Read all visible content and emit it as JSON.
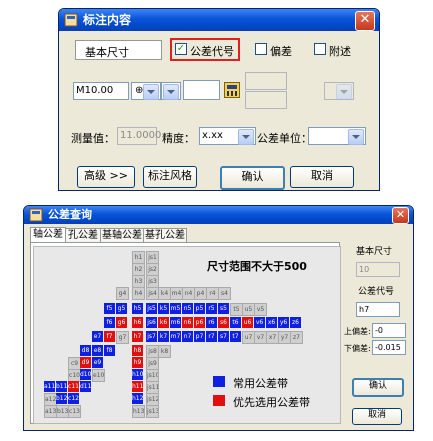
{
  "dialog1": {
    "title": "标注内容",
    "tabs": {
      "basic_size": "基本尺寸",
      "tolerance_code": "公差代号",
      "deviation": "偏差",
      "appendix": "附述"
    },
    "size_value": "M10.00",
    "measured_label": "测量值：",
    "measured_value": "11.0000",
    "precision_label": "精度：",
    "precision_value": "x.xx",
    "tolerance_unit_label": "公差单位：",
    "buttons": {
      "advanced": "高级 >>",
      "style": "标注风格",
      "ok": "确认",
      "cancel": "取消"
    }
  },
  "dialog2": {
    "title": "公差查询",
    "tabs": [
      "轴公差",
      "孔公差",
      "基轴公差",
      "基孔公差"
    ],
    "range_text": "尺寸范围不大于500",
    "legend": {
      "common": "常用公差带",
      "preferred": "优先选用公差带"
    },
    "right": {
      "basic_size_label": "基本尺寸",
      "basic_size_value": "10",
      "code_label": "公差代号",
      "code_value": "h7",
      "upper_label": "上偏差:",
      "upper_value": "-0",
      "lower_label": "下偏差:",
      "lower_value": "-0.015",
      "ok": "确认",
      "cancel": "取消"
    },
    "grid_cells": [
      [
        "h1",
        "d"
      ],
      [
        "h2",
        "d"
      ],
      [
        "h3",
        "d"
      ],
      [
        "js1",
        "d"
      ],
      [
        "js2",
        "d"
      ],
      [
        "js3",
        "d"
      ],
      [
        "g4",
        "d"
      ],
      [
        "h4",
        "d"
      ],
      [
        "js4",
        "d"
      ],
      [
        "k4",
        "d"
      ],
      [
        "m4",
        "d"
      ],
      [
        "n4",
        "d"
      ],
      [
        "p4",
        "d"
      ],
      [
        "r4",
        "d"
      ],
      [
        "s4",
        "d"
      ],
      [
        "f5",
        "b"
      ],
      [
        "g5",
        "b"
      ],
      [
        "h5",
        "b"
      ],
      [
        "js5",
        "b"
      ],
      [
        "k5",
        "b"
      ],
      [
        "m5",
        "b"
      ],
      [
        "n5",
        "b"
      ],
      [
        "p5",
        "b"
      ],
      [
        "r5",
        "b"
      ],
      [
        "s5",
        "b"
      ],
      [
        "t5",
        "d"
      ],
      [
        "u5",
        "d"
      ],
      [
        "v5",
        "d"
      ],
      [
        "f6",
        "b"
      ],
      [
        "g6",
        "r"
      ],
      [
        "h6",
        "r"
      ],
      [
        "js6",
        "b"
      ],
      [
        "k6",
        "r"
      ],
      [
        "m6",
        "b"
      ],
      [
        "n6",
        "r"
      ],
      [
        "p6",
        "r"
      ],
      [
        "r6",
        "b"
      ],
      [
        "s6",
        "r"
      ],
      [
        "t6",
        "b"
      ],
      [
        "u6",
        "r"
      ],
      [
        "v6",
        "b"
      ],
      [
        "x6",
        "b"
      ],
      [
        "y6",
        "b"
      ],
      [
        "z6",
        "b"
      ],
      [
        "e7",
        "b"
      ],
      [
        "f7",
        "r"
      ],
      [
        "g7",
        "d"
      ],
      [
        "h7",
        "r"
      ],
      [
        "js7",
        "b"
      ],
      [
        "k7",
        "b"
      ],
      [
        "m7",
        "b"
      ],
      [
        "n7",
        "b"
      ],
      [
        "p7",
        "b"
      ],
      [
        "r7",
        "b"
      ],
      [
        "s7",
        "b"
      ],
      [
        "t7",
        "b"
      ],
      [
        "u7",
        "d"
      ],
      [
        "v7",
        "d"
      ],
      [
        "x7",
        "d"
      ],
      [
        "y7",
        "d"
      ],
      [
        "z7",
        "d"
      ],
      [
        "d8",
        "b"
      ],
      [
        "e8",
        "b"
      ],
      [
        "f8",
        "b"
      ],
      [
        "h8",
        "r"
      ],
      [
        "js8",
        "d"
      ],
      [
        "k8",
        "d"
      ],
      [
        "c9",
        "d"
      ],
      [
        "d9",
        "r"
      ],
      [
        "e9",
        "b"
      ],
      [
        "h9",
        "r"
      ],
      [
        "js9",
        "d"
      ],
      [
        "c10",
        "d"
      ],
      [
        "d10",
        "b"
      ],
      [
        "e10",
        "d"
      ],
      [
        "h10",
        "b"
      ],
      [
        "js10",
        "d"
      ],
      [
        "a11",
        "b"
      ],
      [
        "b11",
        "b"
      ],
      [
        "c11",
        "r"
      ],
      [
        "d11",
        "b"
      ],
      [
        "h11",
        "r"
      ],
      [
        "js11",
        "d"
      ],
      [
        "a12",
        "d"
      ],
      [
        "b12",
        "b"
      ],
      [
        "c12",
        "b"
      ],
      [
        "h12",
        "b"
      ],
      [
        "js12",
        "d"
      ],
      [
        "a13",
        "d"
      ],
      [
        "b13",
        "d"
      ],
      [
        "c13",
        "d"
      ],
      [
        "h13",
        "d"
      ],
      [
        "js13",
        "d"
      ]
    ]
  }
}
